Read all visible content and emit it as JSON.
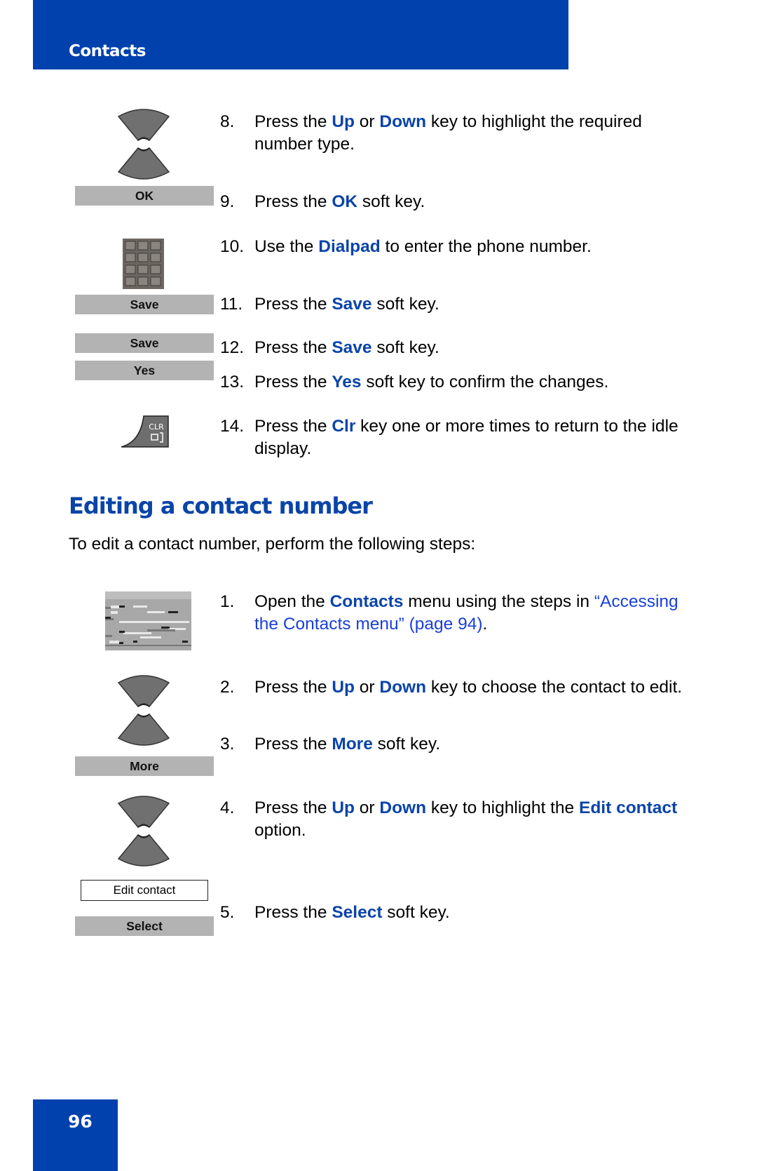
{
  "header": {
    "title": "Contacts"
  },
  "footer": {
    "page_number": "96"
  },
  "section": {
    "title": "Editing a contact number",
    "intro": "To edit a contact number, perform the following steps:"
  },
  "softkeys": {
    "ok": "OK",
    "save_1": "Save",
    "save_2": "Save",
    "yes": "Yes",
    "more": "More",
    "select": "Select"
  },
  "menu_option": "Edit contact",
  "icons": {
    "nav_keys": "up-down-navigation-keys-icon",
    "dialpad": "dialpad-icon",
    "clr": "clr-key-icon",
    "clr_label": "CLR",
    "contacts_screen": "contacts-screen-thumbnail"
  },
  "steps_prev": [
    {
      "num": "8.",
      "parts": [
        [
          "Press the ",
          false
        ],
        [
          "Up",
          true
        ],
        [
          " or ",
          false
        ],
        [
          "Down",
          true
        ],
        [
          " key to highlight the required number type.",
          false
        ]
      ]
    },
    {
      "num": "9.",
      "parts": [
        [
          "Press the ",
          false
        ],
        [
          "OK",
          true
        ],
        [
          " soft key.",
          false
        ]
      ]
    },
    {
      "num": "10.",
      "parts": [
        [
          "Use the ",
          false
        ],
        [
          "Dialpad",
          true
        ],
        [
          " to enter the phone number.",
          false
        ]
      ]
    },
    {
      "num": "11.",
      "parts": [
        [
          "Press the ",
          false
        ],
        [
          "Save",
          true
        ],
        [
          " soft key.",
          false
        ]
      ]
    },
    {
      "num": "12.",
      "parts": [
        [
          "Press the ",
          false
        ],
        [
          "Save",
          true
        ],
        [
          " soft key.",
          false
        ]
      ]
    },
    {
      "num": "13.",
      "parts": [
        [
          "Press the ",
          false
        ],
        [
          "Yes",
          true
        ],
        [
          " soft key to confirm the changes.",
          false
        ]
      ]
    },
    {
      "num": "14.",
      "parts": [
        [
          "Press the ",
          false
        ],
        [
          "Clr",
          true
        ],
        [
          " key one or more times to return to the idle display.",
          false
        ]
      ]
    }
  ],
  "steps_edit": [
    {
      "num": "1.",
      "parts": [
        [
          "Open the ",
          false
        ],
        [
          "Contacts",
          true
        ],
        [
          " menu using the steps in ",
          false
        ],
        [
          "“Accessing the Contacts menu” (page 94)",
          "link"
        ],
        [
          ".",
          false
        ]
      ]
    },
    {
      "num": "2.",
      "parts": [
        [
          "Press the ",
          false
        ],
        [
          "Up",
          true
        ],
        [
          " or ",
          false
        ],
        [
          "Down",
          true
        ],
        [
          " key to choose the contact to edit.",
          false
        ]
      ]
    },
    {
      "num": "3.",
      "parts": [
        [
          "Press the ",
          false
        ],
        [
          "More",
          true
        ],
        [
          " soft key.",
          false
        ]
      ]
    },
    {
      "num": "4.",
      "parts": [
        [
          "Press the ",
          false
        ],
        [
          "Up",
          true
        ],
        [
          " or ",
          false
        ],
        [
          "Down",
          true
        ],
        [
          " key to highlight the ",
          false
        ],
        [
          "Edit contact",
          true
        ],
        [
          " option.",
          false
        ]
      ]
    },
    {
      "num": "5.",
      "parts": [
        [
          "Press the ",
          false
        ],
        [
          "Select",
          true
        ],
        [
          " soft key.",
          false
        ]
      ]
    }
  ]
}
